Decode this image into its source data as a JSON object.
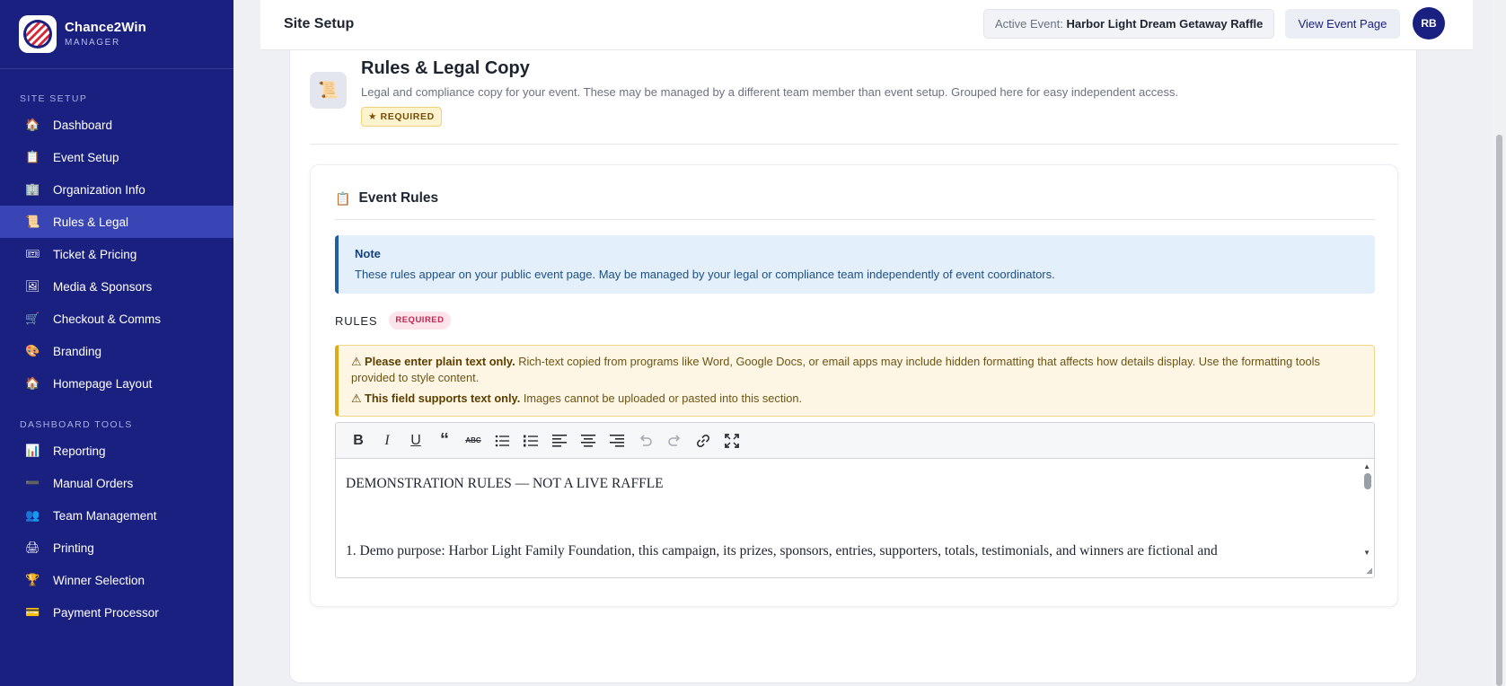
{
  "brand": {
    "name": "Chance2Win",
    "sub": "MANAGER"
  },
  "sidebar": {
    "site_setup_label": "SITE SETUP",
    "site_setup_items": [
      {
        "label": "Dashboard",
        "icon": "🏠"
      },
      {
        "label": "Event Setup",
        "icon": "📋"
      },
      {
        "label": "Organization Info",
        "icon": "🏢"
      },
      {
        "label": "Rules & Legal",
        "icon": "📜"
      },
      {
        "label": "Ticket & Pricing",
        "icon": "🎟"
      },
      {
        "label": "Media & Sponsors",
        "icon": "🖼"
      },
      {
        "label": "Checkout & Comms",
        "icon": "🛒"
      },
      {
        "label": "Branding",
        "icon": "🎨"
      },
      {
        "label": "Homepage Layout",
        "icon": "🏠"
      }
    ],
    "tools_label": "DASHBOARD TOOLS",
    "tools_items": [
      {
        "label": "Reporting",
        "icon": "📊"
      },
      {
        "label": "Manual Orders",
        "icon": "➖"
      },
      {
        "label": "Team Management",
        "icon": "👥"
      },
      {
        "label": "Printing",
        "icon": "🖨"
      },
      {
        "label": "Winner Selection",
        "icon": "🏆"
      },
      {
        "label": "Payment Processor",
        "icon": "💳"
      }
    ]
  },
  "topbar": {
    "title": "Site Setup",
    "active_event_label": "Active Event:",
    "active_event_value": "Harbor Light Dream Getaway Raffle",
    "view_button": "View Event Page",
    "avatar": "RB"
  },
  "page": {
    "icon": "📜",
    "title": "Rules & Legal Copy",
    "description": "Legal and compliance copy for your event. These may be managed by a different team member than event setup. Grouped here for easy independent access.",
    "badge": "★ REQUIRED"
  },
  "section": {
    "icon": "📋",
    "title": "Event Rules",
    "note_title": "Note",
    "note_text": "These rules appear on your public event page. May be managed by your legal or compliance team independently of event coordinators.",
    "rules_label": "RULES",
    "rules_badge": "REQUIRED",
    "warning1_bold": "⚠ Please enter plain text only.",
    "warning1_text": " Rich-text copied from programs like Word, Google Docs, or email apps may include hidden formatting that affects how details display. Use the formatting tools provided to style content.",
    "warning2_bold": "⚠ This field supports text only.",
    "warning2_text": " Images cannot be uploaded or pasted into this section."
  },
  "editor": {
    "line1": "DEMONSTRATION RULES — NOT A LIVE RAFFLE",
    "line2": "1. Demo purpose: Harbor Light Family Foundation, this campaign, its prizes, sponsors, entries, supporters, totals, testimonials, and winners are fictional and"
  }
}
